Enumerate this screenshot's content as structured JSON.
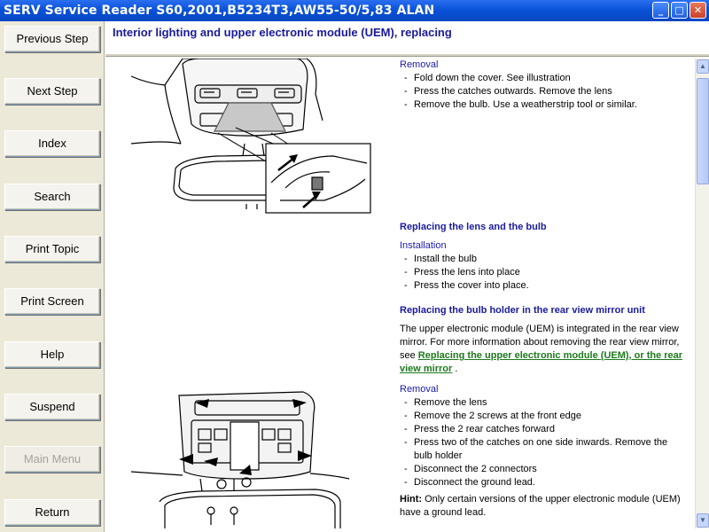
{
  "window": {
    "title": "SERV Service Reader S60,2001,B5234T3,AW55-50/5,83 ALAN",
    "minimize_glyph": "_",
    "maximize_glyph": "□",
    "close_glyph": "✕"
  },
  "nav": {
    "previous_step": "Previous Step",
    "next_step": "Next Step",
    "index": "Index",
    "search": "Search",
    "print_topic": "Print Topic",
    "print_screen": "Print Screen",
    "help": "Help",
    "suspend": "Suspend",
    "main_menu": "Main Menu",
    "return": "Return"
  },
  "header": {
    "title": "Interior lighting and upper electronic module (UEM), replacing"
  },
  "content": {
    "section1": {
      "subheading": "Removal",
      "steps": [
        "Fold down the cover. See illustration",
        "Press the catches outwards. Remove the lens",
        "Remove the bulb. Use a weatherstrip tool or similar."
      ]
    },
    "section2": {
      "heading": "Replacing the lens and the bulb",
      "subheading": "Installation",
      "steps": [
        "Install the bulb",
        "Press the lens into place",
        "Press the cover into place."
      ]
    },
    "section3": {
      "heading": "Replacing the bulb holder in the rear view mirror unit",
      "para_pre": "The upper electronic module (UEM) is integrated in the rear view mirror. For more information about removing the rear view mirror, see ",
      "para_link": "Replacing the upper electronic module (UEM), or the rear view mirror",
      "para_post": " .",
      "subheading": "Removal",
      "steps": [
        "Remove the lens",
        "Remove the 2 screws at the front edge",
        "Press the 2 rear catches forward",
        "Press two of the catches on one side inwards. Remove the bulb holder",
        "Disconnect the 2 connectors",
        "Disconnect the ground lead."
      ],
      "hint_label": "Hint:",
      "hint_text": " Only certain versions of the upper electronic module (UEM) have a ground lead."
    }
  },
  "scrollbar": {
    "up_glyph": "▲",
    "down_glyph": "▼"
  }
}
